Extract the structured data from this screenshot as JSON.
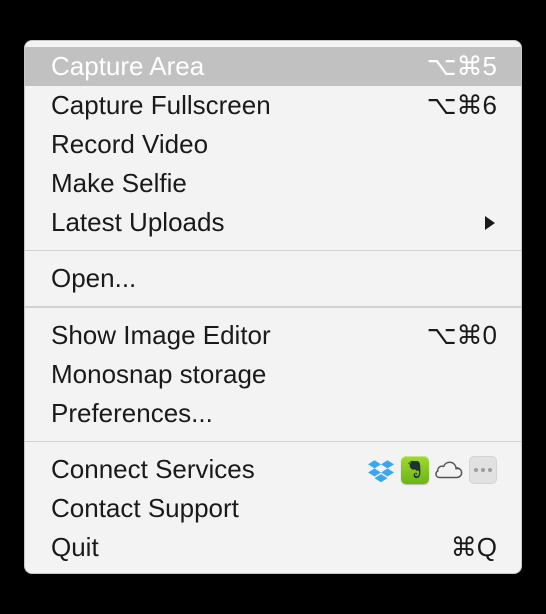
{
  "menu": {
    "section1": [
      {
        "label": "Capture Area",
        "shortcut": "⌥⌘5",
        "highlighted": true
      },
      {
        "label": "Capture Fullscreen",
        "shortcut": "⌥⌘6"
      },
      {
        "label": "Record Video"
      },
      {
        "label": "Make Selfie"
      },
      {
        "label": "Latest Uploads",
        "submenu": true
      }
    ],
    "section2": [
      {
        "label": "Open..."
      }
    ],
    "section3": [
      {
        "label": "Show Image Editor",
        "shortcut": "⌥⌘0"
      },
      {
        "label": "Monosnap storage"
      },
      {
        "label": "Preferences..."
      }
    ],
    "section4": [
      {
        "label": "Connect Services",
        "services": [
          "dropbox",
          "evernote",
          "icloud",
          "more"
        ]
      },
      {
        "label": "Contact Support"
      },
      {
        "label": "Quit",
        "shortcut": "⌘Q"
      }
    ]
  }
}
